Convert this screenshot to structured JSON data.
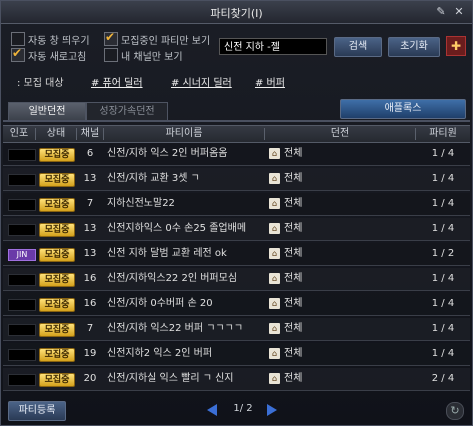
{
  "window": {
    "title": "파티찾기(I)"
  },
  "options": {
    "cb1": {
      "label": "자동 창 띄우기",
      "checked": false
    },
    "cb2": {
      "label": "모집중인 파티만 보기",
      "checked": true
    },
    "cb3": {
      "label": "자동 새로고침",
      "checked": true
    },
    "cb4": {
      "label": "내 채널만 보기",
      "checked": false
    }
  },
  "search": {
    "value": "신전 지하 -젤",
    "button": "검색",
    "reset": "초기화"
  },
  "hints": {
    "label": ": 모집 대상",
    "tag1": "# 퓨어 딜러",
    "tag2": "# 시너지 딜러",
    "tag3": "# 버퍼"
  },
  "tabs": {
    "tab1": "일반던전",
    "tab2": "성장가속던전",
    "special": "애플록스"
  },
  "columns": {
    "c1": "인포",
    "c2": "상태",
    "c3": "채널",
    "c4": "파티이름",
    "c5": "던전",
    "c6": "파티원"
  },
  "rows": [
    {
      "info": "",
      "status": "모집중",
      "channel": "6",
      "name": "신전/지하 익스 2인 버퍼옴옴",
      "dungeon": "전체",
      "members": "1 / 4"
    },
    {
      "info": "",
      "status": "모집중",
      "channel": "13",
      "name": "신전/지하 교환 3셋 ㄱ",
      "dungeon": "전체",
      "members": "1 / 4"
    },
    {
      "info": "",
      "status": "모집중",
      "channel": "7",
      "name": "지하신전노말22",
      "dungeon": "전체",
      "members": "1 / 4"
    },
    {
      "info": "",
      "status": "모집중",
      "channel": "13",
      "name": "신전지하익스 0수 손25 졸업배메",
      "dungeon": "전체",
      "members": "1 / 4"
    },
    {
      "info": "JIN",
      "status": "모집중",
      "channel": "13",
      "name": "신전 지하 달범 교환 레전 ok",
      "dungeon": "전체",
      "members": "1 / 2"
    },
    {
      "info": "",
      "status": "모집중",
      "channel": "16",
      "name": "신전/지하익스22 2인 버퍼모심",
      "dungeon": "전체",
      "members": "1 / 4"
    },
    {
      "info": "",
      "status": "모집중",
      "channel": "16",
      "name": "신전/지하 0수버퍼 손 20",
      "dungeon": "전체",
      "members": "1 / 4"
    },
    {
      "info": "",
      "status": "모집중",
      "channel": "7",
      "name": "신전/지하 익스22 버퍼 ㄱㄱㄱㄱ",
      "dungeon": "전체",
      "members": "1 / 4"
    },
    {
      "info": "",
      "status": "모집중",
      "channel": "19",
      "name": "신전지하2 익스 2인 버퍼",
      "dungeon": "전체",
      "members": "1 / 4"
    },
    {
      "info": "",
      "status": "모집중",
      "channel": "20",
      "name": "신전/지하실 익스 빨리 ㄱ 신지",
      "dungeon": "전체",
      "members": "2 / 4"
    }
  ],
  "footer": {
    "register": "파티등록",
    "page": "1/ 2"
  },
  "colors": {
    "accent": "#f0b43a",
    "button": "#3a5070"
  }
}
